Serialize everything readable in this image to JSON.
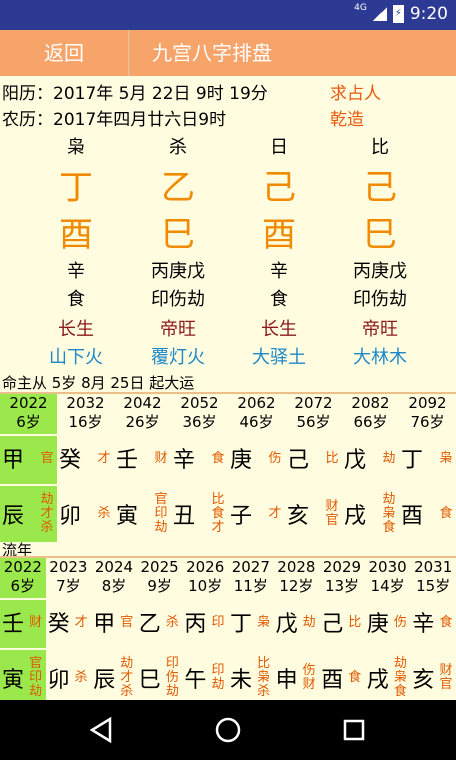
{
  "status": {
    "network": "4G",
    "time": "9:20"
  },
  "toolbar": {
    "back": "返回",
    "title": "九宫八字排盘"
  },
  "info": {
    "solar": "阳历：2017年  5月 22日 9时 19分",
    "lunar": "农历：2017年四月廿六日9时",
    "link1": "求占人",
    "link2": "乾造"
  },
  "pillars": [
    {
      "label": "枭",
      "stem": "丁",
      "branch": "酉",
      "hidden": "辛",
      "shishen": "食",
      "changsheng": "长生",
      "nayin": "山下火"
    },
    {
      "label": "杀",
      "stem": "乙",
      "branch": "巳",
      "hidden": "丙庚戊",
      "shishen": "印伤劫",
      "changsheng": "帝旺",
      "nayin": "覆灯火"
    },
    {
      "label": "日",
      "stem": "己",
      "branch": "酉",
      "hidden": "辛",
      "shishen": "食",
      "changsheng": "长生",
      "nayin": "大驿土"
    },
    {
      "label": "比",
      "stem": "己",
      "branch": "巳",
      "hidden": "丙庚戊",
      "shishen": "印伤劫",
      "changsheng": "帝旺",
      "nayin": "大林木"
    }
  ],
  "dayun": {
    "title": "命主从 5岁 8月 25日  起大运",
    "years": [
      "2022",
      "2032",
      "2042",
      "2052",
      "2062",
      "2072",
      "2082",
      "2092"
    ],
    "ages": [
      "6岁",
      "16岁",
      "26岁",
      "36岁",
      "46岁",
      "56岁",
      "66岁",
      "76岁"
    ],
    "stems": [
      {
        "g": "甲",
        "s": "官"
      },
      {
        "g": "癸",
        "s": "才"
      },
      {
        "g": "壬",
        "s": "财"
      },
      {
        "g": "辛",
        "s": "食"
      },
      {
        "g": "庚",
        "s": "伤"
      },
      {
        "g": "己",
        "s": "比"
      },
      {
        "g": "戊",
        "s": "劫"
      },
      {
        "g": "丁",
        "s": "枭"
      }
    ],
    "branches": [
      {
        "g": "辰",
        "s": "劫\n才\n杀"
      },
      {
        "g": "卯",
        "s": "杀"
      },
      {
        "g": "寅",
        "s": "官\n印\n劫"
      },
      {
        "g": "丑",
        "s": "比\n食\n才"
      },
      {
        "g": "子",
        "s": "才"
      },
      {
        "g": "亥",
        "s": "财\n官"
      },
      {
        "g": "戌",
        "s": "劫\n枭\n食"
      },
      {
        "g": "酉",
        "s": "食"
      }
    ]
  },
  "liunian": {
    "title": "流年",
    "years": [
      "2022",
      "2023",
      "2024",
      "2025",
      "2026",
      "2027",
      "2028",
      "2029",
      "2030",
      "2031"
    ],
    "ages": [
      "6岁",
      "7岁",
      "8岁",
      "9岁",
      "10岁",
      "11岁",
      "12岁",
      "13岁",
      "14岁",
      "15岁"
    ],
    "stems": [
      {
        "g": "壬",
        "s": "财"
      },
      {
        "g": "癸",
        "s": "才"
      },
      {
        "g": "甲",
        "s": "官"
      },
      {
        "g": "乙",
        "s": "杀"
      },
      {
        "g": "丙",
        "s": "印"
      },
      {
        "g": "丁",
        "s": "枭"
      },
      {
        "g": "戊",
        "s": "劫"
      },
      {
        "g": "己",
        "s": "比"
      },
      {
        "g": "庚",
        "s": "伤"
      },
      {
        "g": "辛",
        "s": "食"
      }
    ],
    "branches": [
      {
        "g": "寅",
        "s": "官\n印\n劫"
      },
      {
        "g": "卯",
        "s": "杀"
      },
      {
        "g": "辰",
        "s": "劫\n才\n杀"
      },
      {
        "g": "巳",
        "s": "印\n伤\n劫"
      },
      {
        "g": "午",
        "s": "印\n劫"
      },
      {
        "g": "未",
        "s": "比\n枭\n杀"
      },
      {
        "g": "申",
        "s": "伤\n财"
      },
      {
        "g": "酉",
        "s": "食"
      },
      {
        "g": "戌",
        "s": "劫\n枭\n食"
      },
      {
        "g": "亥",
        "s": "财\n官"
      }
    ]
  },
  "colors": {
    "header": "#F6A46A",
    "status": "#2D3A93",
    "selected": "#9BE84D",
    "stem": "#F08A00",
    "nayin": "#1E88C8"
  }
}
